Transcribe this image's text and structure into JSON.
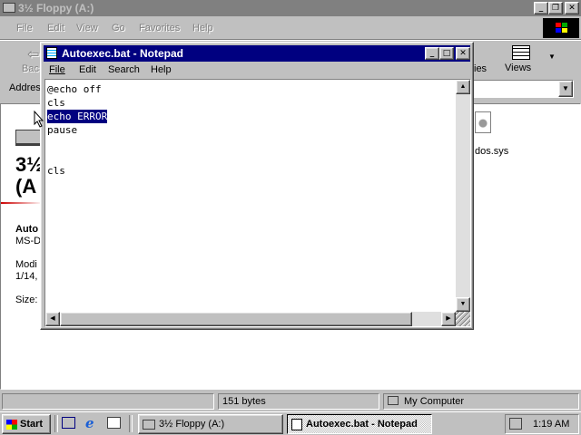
{
  "explorer": {
    "title": "3½ Floppy (A:)",
    "menu": [
      "File",
      "Edit",
      "View",
      "Go",
      "Favorites",
      "Help"
    ],
    "toolbar_back": "Bac",
    "toolbar_views_left": "ies",
    "toolbar_views": "Views",
    "address_label": "Address",
    "drive_title_line1": "3½",
    "drive_title_line2": "(A",
    "info_name": "Auto",
    "info_type": "MS-D",
    "info_modified_label": "Modi",
    "info_modified_date": "1/14,",
    "info_size": "Size:",
    "file_label": "dos.sys",
    "status_size": "151 bytes",
    "status_zone": "My Computer"
  },
  "notepad": {
    "title": "Autoexec.bat - Notepad",
    "menu": [
      "File",
      "Edit",
      "Search",
      "Help"
    ],
    "lines": [
      "@echo off",
      "cls",
      "echo ERROR",
      "pause",
      "",
      "",
      "cls"
    ],
    "selected_line": 2
  },
  "taskbar": {
    "start": "Start",
    "task1": "3½ Floppy (A:)",
    "task2": "Autoexec.bat - Notepad",
    "clock": "1:19 AM"
  }
}
